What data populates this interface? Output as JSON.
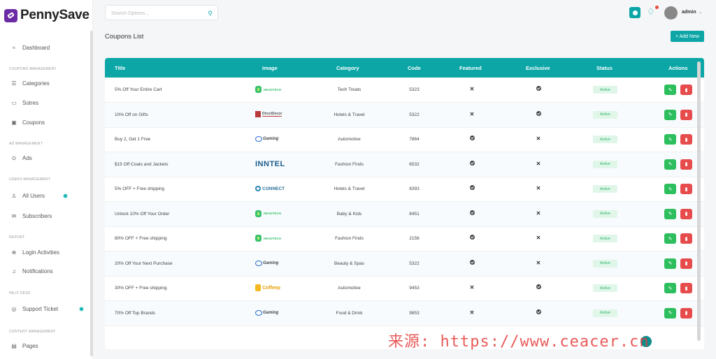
{
  "app": {
    "name": "PennySave"
  },
  "sidebar": {
    "items": [
      {
        "type": "item",
        "label": "Dashboard",
        "icon": "dashboard-icon",
        "glyph": "≈"
      },
      {
        "type": "head",
        "label": "COUPONS MANAGEMENT"
      },
      {
        "type": "item",
        "label": "Categories",
        "icon": "list-icon",
        "glyph": "☰"
      },
      {
        "type": "item",
        "label": "Sotres",
        "icon": "store-icon",
        "glyph": "▭"
      },
      {
        "type": "item",
        "label": "Coupons",
        "icon": "coupon-icon",
        "glyph": "▣"
      },
      {
        "type": "head",
        "label": "AD MANAGEMENT"
      },
      {
        "type": "item",
        "label": "Ads",
        "icon": "ads-icon",
        "glyph": "⊙"
      },
      {
        "type": "head",
        "label": "USERS MANAGEMENT"
      },
      {
        "type": "item",
        "label": "All Users",
        "icon": "user-icon",
        "glyph": "♙"
      },
      {
        "type": "item",
        "label": "Subscribers",
        "icon": "mail-icon",
        "glyph": "✉"
      },
      {
        "type": "head",
        "label": "REPORT"
      },
      {
        "type": "item",
        "label": "Login Activities",
        "icon": "login-icon",
        "glyph": "⊕"
      },
      {
        "type": "item",
        "label": "Notifications",
        "icon": "bell-icon",
        "glyph": "♫"
      },
      {
        "type": "head",
        "label": "HELP DESK"
      },
      {
        "type": "item",
        "label": "Support Ticket",
        "icon": "support-icon",
        "glyph": "◎"
      },
      {
        "type": "head",
        "label": "CONTENT MANAGEMENT"
      },
      {
        "type": "item",
        "label": "Pages",
        "icon": "pages-icon",
        "glyph": "▤"
      }
    ]
  },
  "header": {
    "search_placeholder": "Search Options...",
    "user": "admin"
  },
  "page": {
    "title": "Coupons List",
    "add_label": "+ Add New"
  },
  "table": {
    "columns": [
      "Title",
      "Image",
      "Category",
      "Code",
      "Featured",
      "Exclusive",
      "Status",
      "Actions"
    ],
    "rows": [
      {
        "title": "5% Off Your Entire Cart",
        "logo": "headtech",
        "category": "Tech Treats",
        "code": "5323",
        "featured": false,
        "exclusive": true,
        "status": "Active"
      },
      {
        "title": "10% Off on Gifts",
        "logo": "directdecor",
        "category": "Hotels & Travel",
        "code": "5322",
        "featured": false,
        "exclusive": true,
        "status": "Active"
      },
      {
        "title": "Buy 2, Get 1 Free",
        "logo": "gaming",
        "category": "Automotive",
        "code": "7864",
        "featured": true,
        "exclusive": false,
        "status": "Active"
      },
      {
        "title": "$15 Off Coats and Jackets",
        "logo": "inntel",
        "category": "Fashion Finds",
        "code": "6532",
        "featured": true,
        "exclusive": false,
        "status": "Active"
      },
      {
        "title": "5% OFF + Free shipping",
        "logo": "connect",
        "category": "Hotels & Travel",
        "code": "8393",
        "featured": true,
        "exclusive": false,
        "status": "Active"
      },
      {
        "title": "Unlock 10% Off Your Order",
        "logo": "headtech",
        "category": "Baby & Kids",
        "code": "8451",
        "featured": true,
        "exclusive": false,
        "status": "Active"
      },
      {
        "title": "80% OFF + Free shipping",
        "logo": "headtech",
        "category": "Fashion Finds",
        "code": "2156",
        "featured": true,
        "exclusive": false,
        "status": "Active"
      },
      {
        "title": "20% Off Your Next Purchase",
        "logo": "gaming",
        "category": "Beauty & Spas",
        "code": "5322",
        "featured": true,
        "exclusive": false,
        "status": "Active"
      },
      {
        "title": "30% OFF + Free shipping",
        "logo": "coffeep",
        "category": "Automotive",
        "code": "9453",
        "featured": false,
        "exclusive": true,
        "status": "Active"
      },
      {
        "title": "70% Off Top Brands",
        "logo": "gaming",
        "category": "Food & Drink",
        "code": "9853",
        "featured": false,
        "exclusive": true,
        "status": "Active"
      }
    ]
  },
  "logos": {
    "headtech": "HEADTECH",
    "directdecor": "DirectDecor",
    "gaming": "Gaming",
    "inntel": "INNTEL",
    "connect": "CONNECT",
    "coffeep": "Coffeep"
  },
  "watermark": "来源: https://www.ceacer.cn",
  "colors": {
    "brand": "#0ca6a7",
    "logo": "#6b2ba5",
    "edit": "#2dbe5e",
    "delete": "#e74c4c",
    "active_badge": "#dff6e8"
  }
}
